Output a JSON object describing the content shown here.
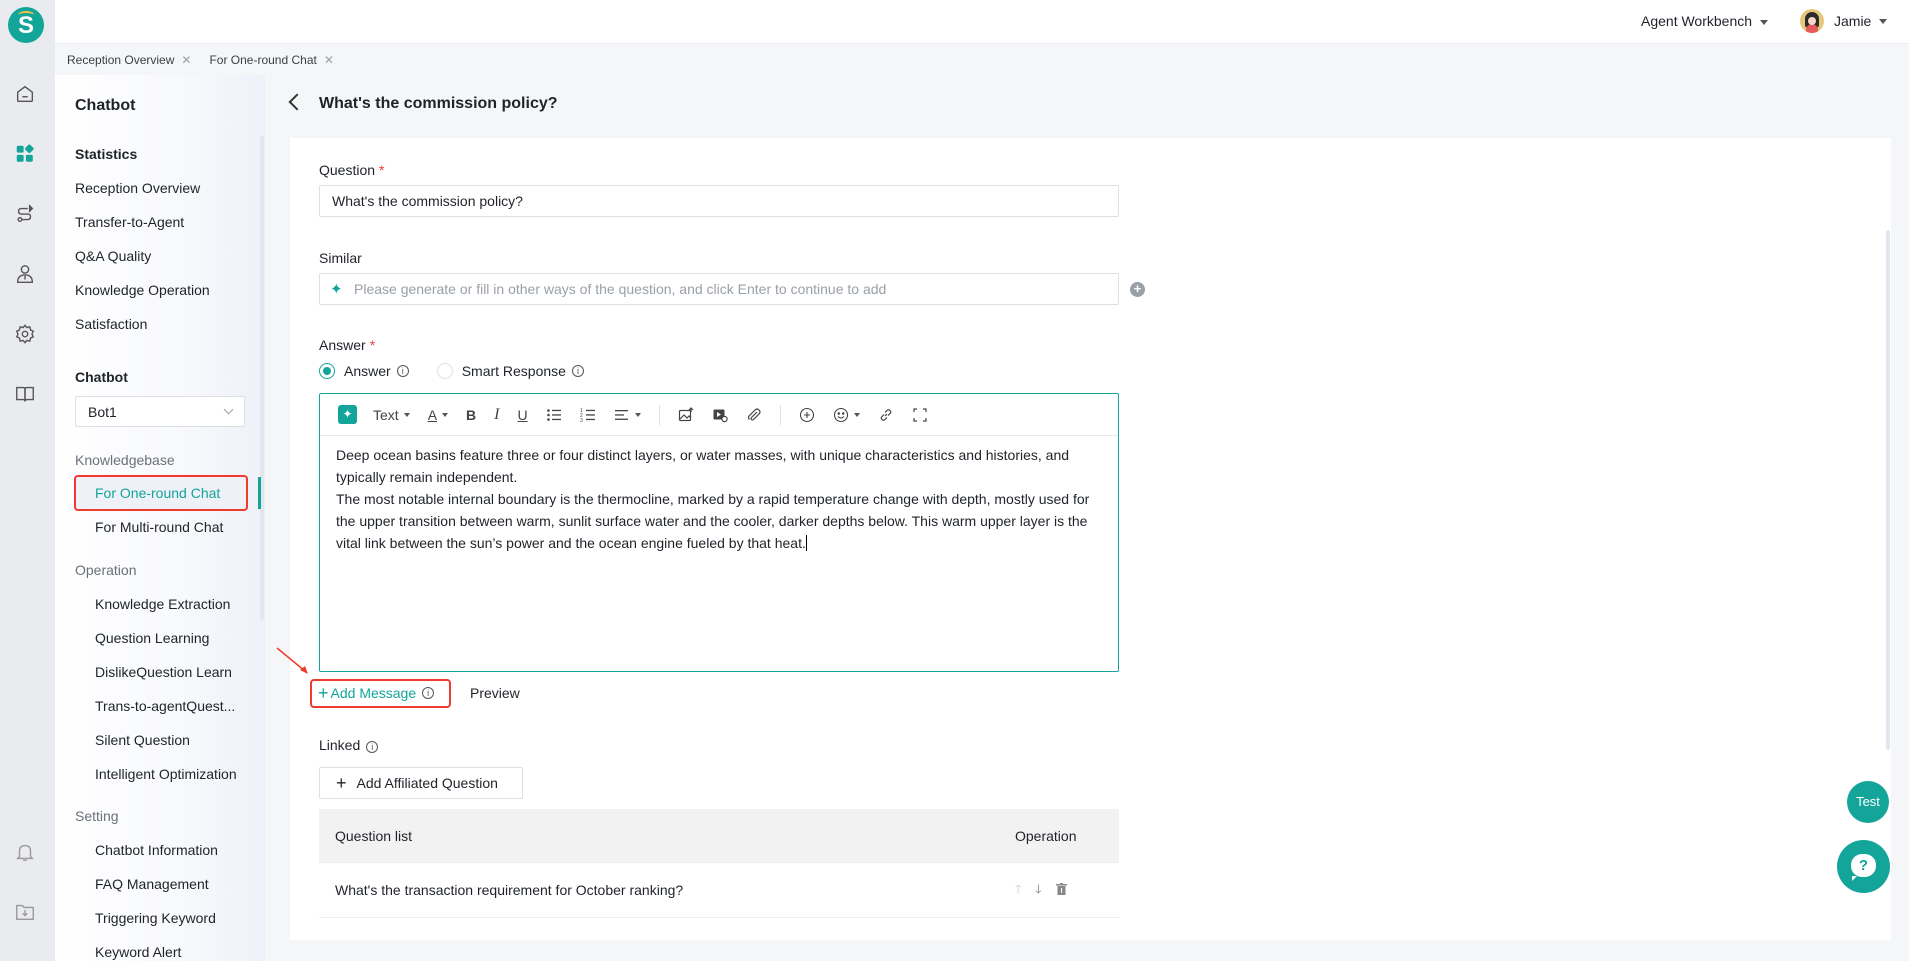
{
  "header": {
    "workbench_label": "Agent Workbench",
    "user_name": "Jamie"
  },
  "rail": {
    "icons": [
      "home-icon",
      "dashboard-icon",
      "route-icon",
      "agent-icon",
      "settings-icon",
      "book-icon",
      "bell-icon",
      "download-folder-icon"
    ]
  },
  "tabs": [
    {
      "label": "Reception Overview"
    },
    {
      "label": "For One-round Chat"
    }
  ],
  "sidebar": {
    "title": "Chatbot",
    "statistics": {
      "heading": "Statistics",
      "items": [
        "Reception Overview",
        "Transfer-to-Agent",
        "Q&A Quality",
        "Knowledge Operation",
        "Satisfaction"
      ]
    },
    "chatbot": {
      "heading": "Chatbot",
      "selected_bot": "Bot1"
    },
    "knowledgebase": {
      "heading": "Knowledgebase",
      "items": [
        "For One-round Chat",
        "For Multi-round Chat"
      ],
      "active": "For One-round Chat"
    },
    "operation": {
      "heading": "Operation",
      "items": [
        "Knowledge Extraction",
        "Question Learning",
        "DislikeQuestion Learn",
        "Trans-to-agentQuest...",
        "Silent Question",
        "Intelligent Optimization"
      ]
    },
    "setting": {
      "heading": "Setting",
      "items": [
        "Chatbot Information",
        "FAQ Management",
        "Triggering Keyword",
        "Keyword Alert"
      ]
    }
  },
  "page": {
    "title": "What's the commission policy?",
    "question_label": "Question",
    "question_value": "What's the commission policy?",
    "similar_label": "Similar",
    "similar_placeholder": "Please generate or fill in other ways of the question, and click Enter to continue to add",
    "answer_label": "Answer",
    "required_mark": "*",
    "radio": {
      "options": [
        "Answer",
        "Smart Response"
      ],
      "selected": "Answer"
    },
    "editor": {
      "text_style": "Text",
      "paragraphs": [
        "Deep ocean basins feature three or four distinct layers, or water masses, with unique characteristics and histories, and typically remain independent.",
        "The most notable internal boundary is the thermocline, marked by a rapid temperature change with depth, mostly used for the upper transition between warm, sunlit surface water and the cooler, darker depths below. This warm upper layer is the vital link between the sun’s power and the ocean engine fueled by that heat."
      ]
    },
    "add_message_label": "Add Message",
    "preview_label": "Preview",
    "linked_label": "Linked",
    "add_affiliated_label": "Add Affiliated Question",
    "table": {
      "columns": [
        "Question list",
        "Operation"
      ],
      "rows": [
        {
          "question": "What's the transaction requirement for October ranking?"
        }
      ]
    }
  },
  "floating": {
    "test_label": "Test",
    "help_label": "?"
  },
  "colors": {
    "accent": "#13a49a",
    "annotation": "#f03a2f"
  }
}
